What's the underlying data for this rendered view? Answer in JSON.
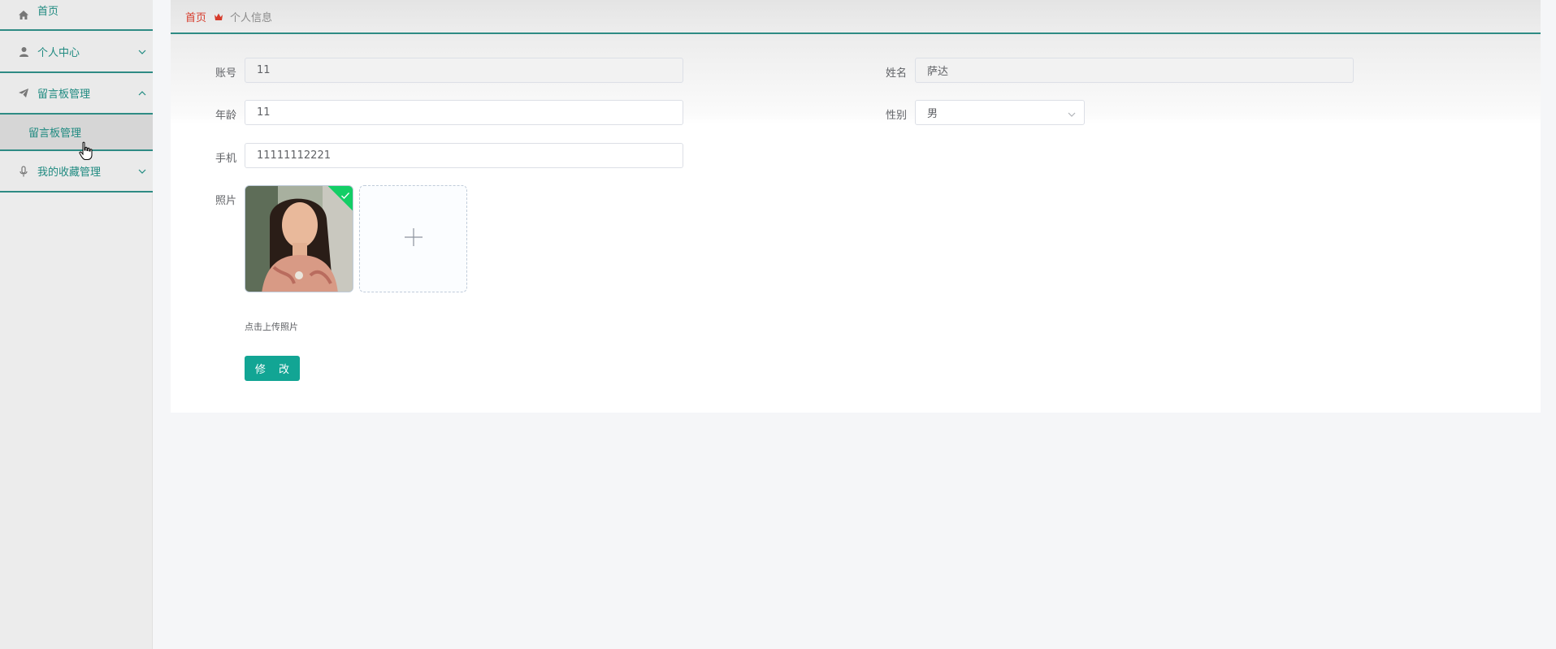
{
  "sidebar": {
    "home": {
      "label": "首页",
      "icon": "home-icon"
    },
    "personal": {
      "label": "个人中心",
      "icon": "user-icon"
    },
    "messageboard": {
      "label": "留言板管理",
      "icon": "paper-plane-icon"
    },
    "messageboard_sub": {
      "label": "留言板管理"
    },
    "favorites": {
      "label": "我的收藏管理",
      "icon": "microphone-icon"
    }
  },
  "breadcrumb": {
    "home": "首页",
    "current": "个人信息"
  },
  "form": {
    "account": {
      "label": "账号",
      "value": "11"
    },
    "name": {
      "label": "姓名",
      "value": "萨达"
    },
    "age": {
      "label": "年龄",
      "value": "11"
    },
    "gender": {
      "label": "性别",
      "value": "男"
    },
    "phone": {
      "label": "手机",
      "value": "11111112221"
    },
    "photo": {
      "label": "照片",
      "hint": "点击上传照片"
    },
    "submit_label": "修 改"
  },
  "colors": {
    "accent": "#12a594",
    "nav_text": "#1f8a80",
    "breadcrumb_home": "#d63b2b",
    "upload_success": "#13ce66"
  }
}
